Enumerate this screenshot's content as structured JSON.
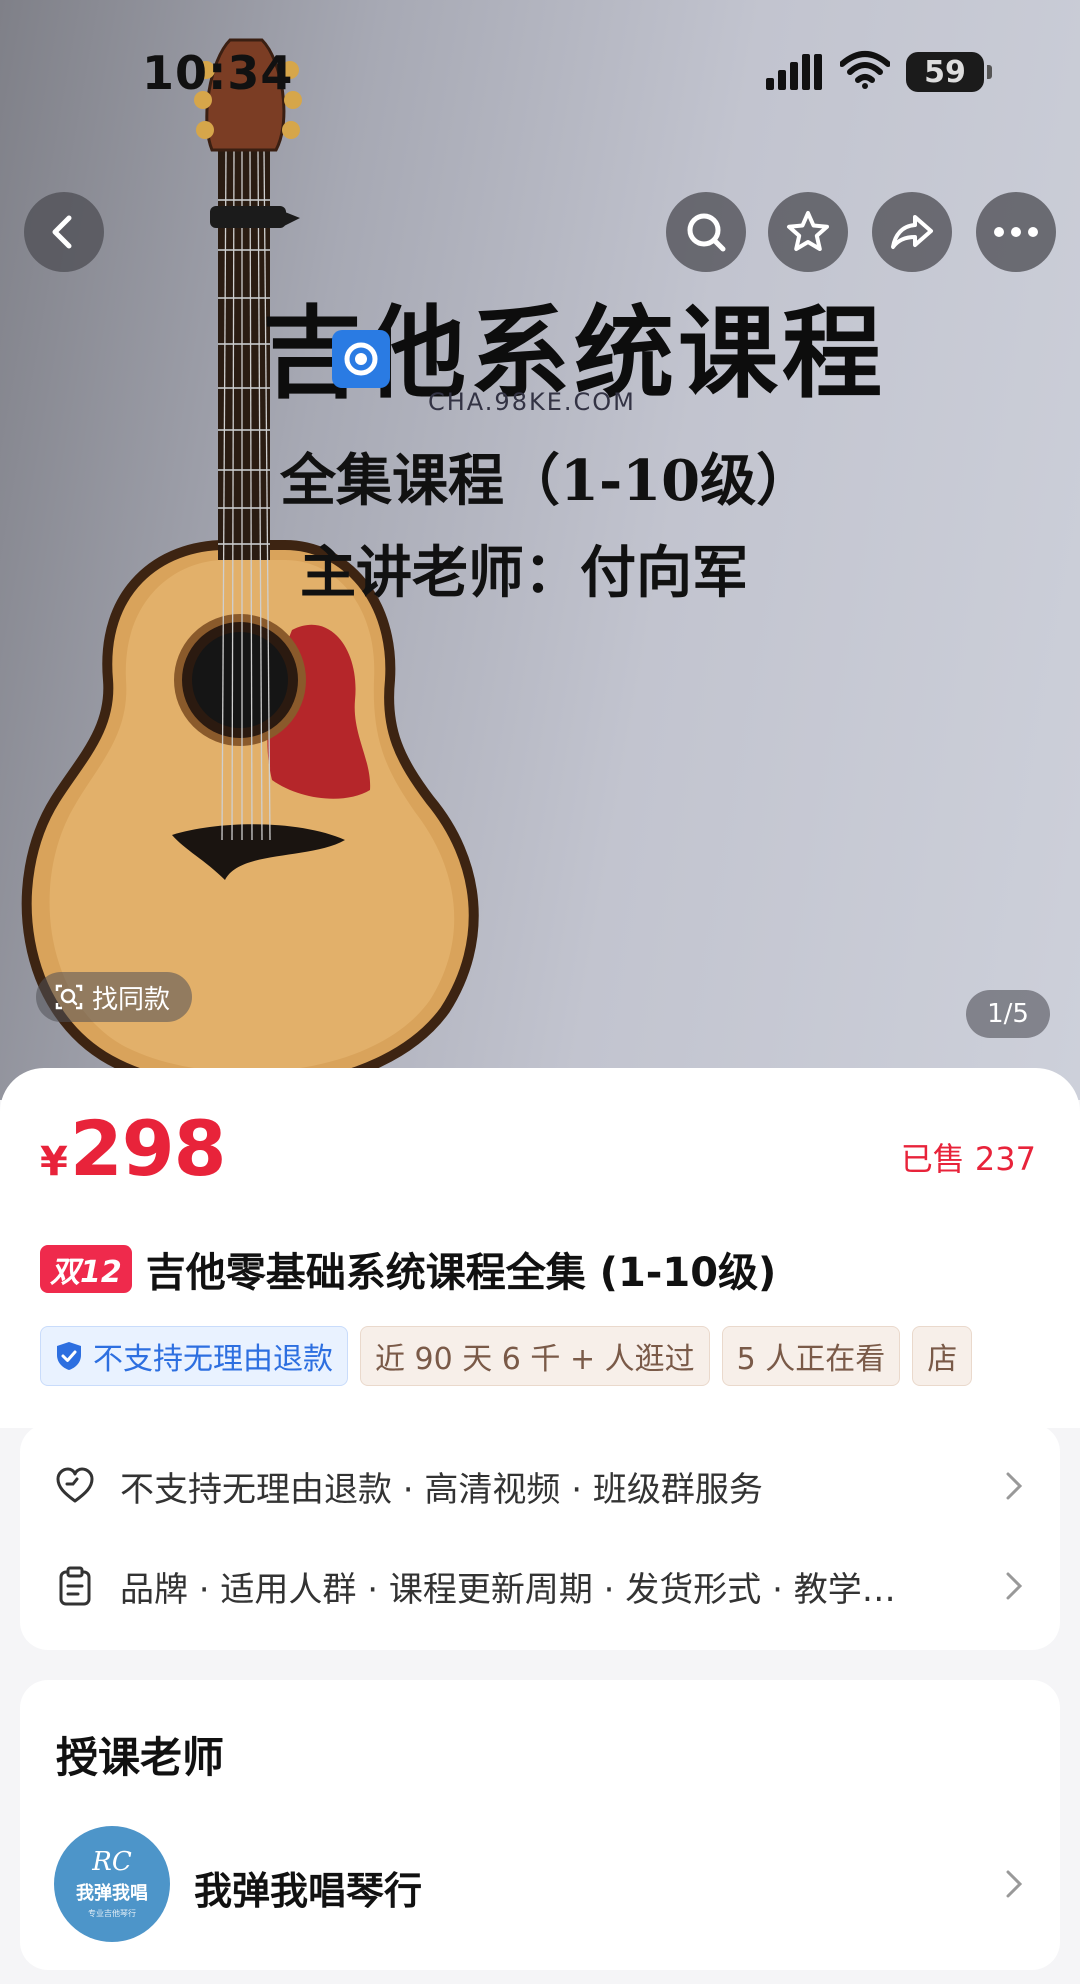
{
  "status_bar": {
    "time": "10:34",
    "battery": "59"
  },
  "nav": {
    "back_icon": "chevron-left-icon",
    "search_icon": "search-icon",
    "favorite_icon": "star-icon",
    "share_icon": "share-icon",
    "more_icon": "more-icon"
  },
  "hero": {
    "title": "吉他系统课程",
    "subtitle": "全集课程（1-10级）",
    "teacher_line": "主讲老师：付向军",
    "watermark": "CHA.98KE.COM",
    "find_same": "找同款",
    "page_indicator": "1/5"
  },
  "product": {
    "currency": "¥",
    "price": "298",
    "sold": "已售 237",
    "promo_badge": "双12",
    "title": "吉他零基础系统课程全集 (1-10级)",
    "tags": [
      "不支持无理由退款",
      "近 90 天 6 千 + 人逛过",
      "5 人正在看",
      "店"
    ]
  },
  "service": {
    "row1": "不支持无理由退款 · 高清视频 · 班级群服务",
    "row2": "品牌 · 适用人群 · 课程更新周期 · 发货形式 · 教学…"
  },
  "teacher": {
    "heading": "授课老师",
    "avatar_mono": "RC",
    "avatar_brand": "我弹我唱",
    "avatar_tiny": "专业吉他琴行",
    "name": "我弹我唱琴行"
  },
  "colors": {
    "price_red": "#e8233a",
    "tag_blue": "#2d6fe0",
    "promo_red": "#ef2a4c"
  }
}
